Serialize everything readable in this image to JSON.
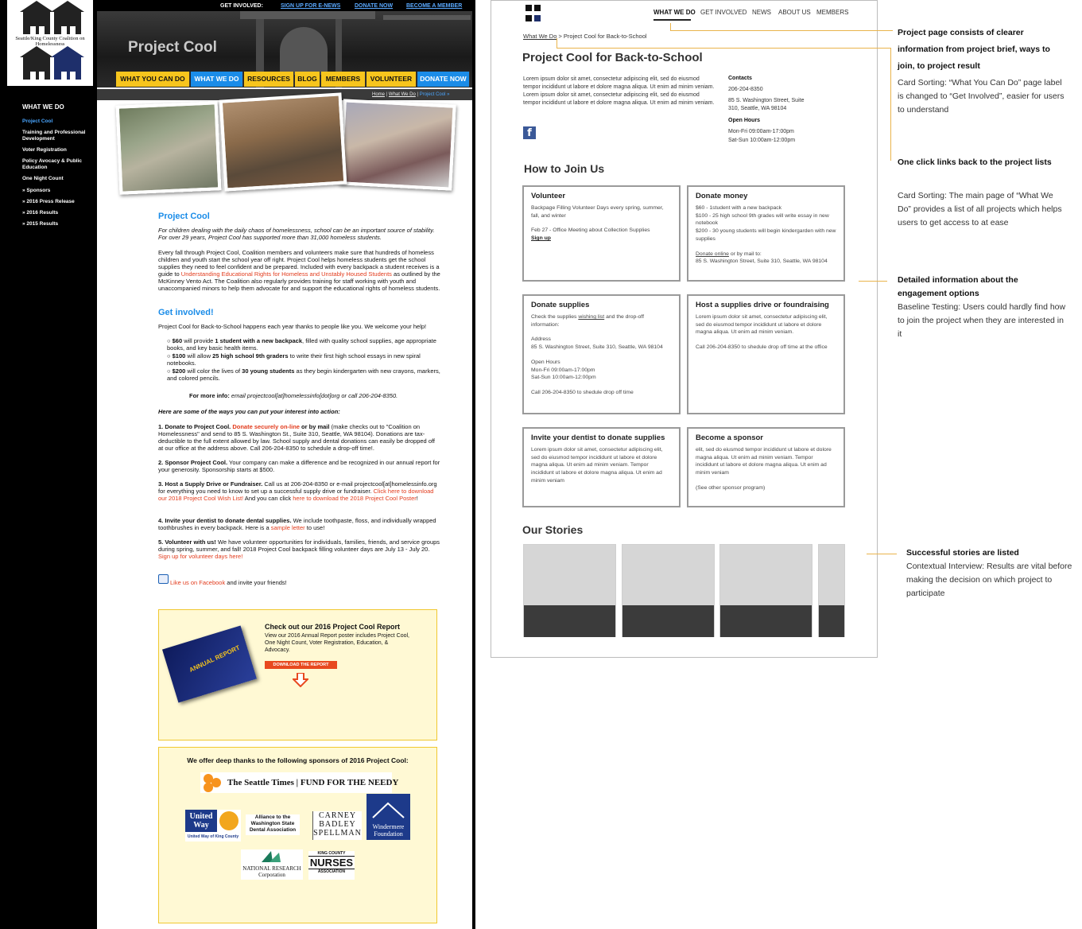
{
  "original": {
    "logo_text": "Seattle/King County Coalition on Homelessness",
    "top_links": {
      "label": "GET INVOLVED:",
      "enews": "SIGN UP FOR E-NEWS",
      "donate": "DONATE NOW",
      "member": "BECOME A MEMBER"
    },
    "hero_title": "Project Cool",
    "nav": [
      "WHAT YOU CAN DO",
      "WHAT WE DO",
      "RESOURCES",
      "BLOG",
      "MEMBERS",
      "VOLUNTEER",
      "DONATE NOW"
    ],
    "breadcrumb": {
      "home": "Home",
      "sep": " | ",
      "section": "What We Do",
      "current": "Project Cool »"
    },
    "sidebar": {
      "title": "WHAT WE DO",
      "items": [
        "Project Cool",
        "Training and Professional Development",
        "Voter Registration",
        "Policy Avocacy & Public Education",
        "One Night Count",
        "» Sponsors",
        "» 2016 Press Release",
        "» 2016 Results",
        "» 2015 Results"
      ]
    },
    "heading1": "Project Cool",
    "intro_italic": "For children dealing with the daily chaos of homelessness, school can be an important source of stability. For over 29 years, Project Cool has supported more than 31,000 homeless students.",
    "para1_a": "Every fall through Project Cool, Coalition members and volunteers make sure that hundreds of homeless children and youth start the school year off right. Project Cool helps homeless students get the school supplies they need to feel confident and be prepared. Included with every backpack a student receives is a guide to ",
    "para1_link": "Understanding Educational Rights for Homeless and Unstably Housed Students",
    "para1_b": " as outlined by the McKinney Vento Act. The Coalition also regularly provides training for staff working with youth and unaccompanied minors to help them advocate for and support the educational rights of homeless students.",
    "heading2": "Get involved!",
    "get_involved_text": "Project Cool for Back-to-School happens each year thanks to people like you. We welcome your help!",
    "bullets": [
      {
        "amt": "$60",
        "mid": " will provide ",
        "bold": "1 student with a new backpack",
        "rest": ", filled with quality school supplies, age appropriate books, and key basic health items."
      },
      {
        "amt": "$100",
        "mid": " will allow ",
        "bold": "25 high school 9th graders",
        "rest": " to write their first high school essays in new spiral notebooks."
      },
      {
        "amt": "$200",
        "mid": " will color the lives of ",
        "bold": "30 young students",
        "rest": " as they begin kindergarten with new crayons, markers, and colored pencils."
      }
    ],
    "more_info_label": "For more info:",
    "more_info_text": " email projectcool[at]homelessinfo[dot]org or call 206-204-8350.",
    "ways_intro": "Here are some of the ways you can put your interest into action:",
    "ways": [
      {
        "bold": "1. Donate to Project Cool.",
        "link": " Donate securely on-line",
        "bold2": " or by mail",
        "rest": " (make checks out to \"Coalition on Homelessness\" and send to 85 S. Washington St., Suite 310, Seattle, WA 98104). Donations are tax-deductible to the full extent allowed by law. School supply and dental donations can easily be dropped off at our office at the address above. Call 206-204-8350 to schedule a drop-off time!."
      },
      {
        "bold": "2. Sponsor Project Cool.",
        "link": "",
        "bold2": "",
        "rest": " Your company can make a difference and be recognized in our annual report for your generosity. Sponsorship starts at $500."
      },
      {
        "bold": "3. Host a Supply Drive or Fundraiser.",
        "link": "",
        "bold2": "",
        "rest": " Call us at 206-204-8350 or e-mail projectcool[at]homelessinfo.org for everything you need to know to set up a successful supply drive or fundraiser. ",
        "link2": "Click here to download our 2018 Project Cool Wish List!",
        "rest2": " And you can click ",
        "link3": "here to download the 2018 Project Cool Poster",
        "rest3": "!"
      },
      {
        "bold": "4. Invite your dentist to donate dental supplies.",
        "link": "",
        "bold2": "",
        "rest": " We include toothpaste, floss, and individually wrapped toothbrushes in every backpack. Here is a ",
        "link2": "sample letter",
        "rest2": " to use!"
      },
      {
        "bold": "5. Volunteer with us!",
        "link": "",
        "bold2": "",
        "rest": " We have volunteer opportunities for individuals, families, friends, and service groups during spring, summer, and fall! 2018 Project Cool backpack filling volunteer days are July 13 - July 20. ",
        "link2": "Sign up for volunteer days here!"
      }
    ],
    "facebook_link": "Like us on Facebook",
    "facebook_rest": " and invite your friends!",
    "report": {
      "title": "Check out our 2016 Project Cool Report",
      "text": "View our 2016 Annual Report poster includes Project Cool, One Night Count, Voter Registration, Education, & Advocacy.",
      "book_label": "ANNUAL REPORT",
      "button": "DOWNLOAD THE REPORT"
    },
    "sponsors": {
      "title": "We offer deep thanks to the following sponsors of 2016 Project Cool:",
      "seattle_times": "The Seattle Times | FUND FOR THE NEEDY",
      "united_way": "United Way",
      "united_way_sub": "United Way of King County",
      "alliance": "Alliance to the Washington State Dental Association",
      "carney": "CARNEY BADLEY SPELLMAN",
      "windermere": "Windermere Foundation",
      "nrc": "NATIONAL RESEARCH Corporation",
      "kc_nurses_top": "KING COUNTY",
      "kc_nurses": "NURSES",
      "kc_nurses_bottom": "ASSOCIATION"
    }
  },
  "wireframe": {
    "nav": [
      "WHAT WE DO",
      "GET INVOLVED",
      "NEWS",
      "ABOUT US",
      "MEMBERS"
    ],
    "breadcrumb_link": "What We Do",
    "breadcrumb_rest": " > Project Cool for Back-to-School",
    "title": "Project Cool for Back-to-School",
    "intro": "Lorem ipsum dolor sit amet, consectetur adipiscing elit, sed do eiusmod tempor incididunt ut labore et dolore magna aliqua. Ut enim ad minim veniam. Lorem ipsum dolor sit amet, consectetur adipiscing elit, sed do eiusmod tempor incididunt ut labore et dolore magna aliqua. Ut enim ad minim veniam.",
    "contacts_label": "Contacts",
    "phone": "206-204-8350",
    "address": "85 S. Washington Street, Suite 310, Seattle, WA 98104",
    "hours_label": "Open Hours",
    "hours": [
      "Mon-Fri 09:00am-17:00pm",
      "Sat-Sun 10:00am-12:00pm"
    ],
    "how_to_join": "How to Join Us",
    "cards": [
      {
        "title": "Volunteer",
        "lines": [
          "Backpage Filling Volunteer Days every spring, summer, fall, and winter",
          "",
          "Feb 27 - Office Meeting about Collection Supplies"
        ],
        "link": "Sign up"
      },
      {
        "title": "Donate money",
        "lines": [
          "$60 - 1student with a new backpack",
          "$100 - 25 high school 9th grades will write essay in new notebook",
          "$200 - 30 young students will begin kindergarden with new supplies",
          ""
        ],
        "link": "Donate online",
        "after": " or by mail to:",
        "tail": "85 S. Washington Street, Suite 310, Seattle, WA 98104"
      },
      {
        "title": "Donate supplies",
        "pre": "Check the supplies ",
        "link": "wishing list",
        "after": " and the drop-off information:",
        "lines": [
          "",
          "Address",
          "85 S. Washington Street, Suite 310, Seattle, WA 98104",
          "",
          "Open Hours",
          "Mon-Fri 09:00am-17:00pm",
          "Sat-Sun 10:00am-12:00pm",
          "",
          "Call 206-204-8350 to shedule drop off time"
        ]
      },
      {
        "title": "Host a supplies drive or foundraising",
        "lines": [
          "Lorem ipsum dolor sit amet, consectetur adipiscing elit, sed do eiusmod tempor incididunt ut labore et dolore magna aliqua. Ut enim ad minim veniam.",
          "",
          "Call 206-204-8350 to shedule drop off time at the office"
        ]
      },
      {
        "title": "Invite your dentist to donate supplies",
        "lines": [
          "Lorem ipsum dolor sit amet, consectetur adipiscing elit, sed do eiusmod tempor incididunt ut labore et dolore magna aliqua. Ut enim ad minim veniam. Tempor incididunt ut labore et dolore magna aliqua. Ut enim ad minim veniam"
        ]
      },
      {
        "title": "Become a sponsor",
        "lines": [
          "elit, sed do eiusmod tempor incididunt ut labore et dolore magna aliqua. Ut enim ad minim veniam. Tempor incididunt ut labore et dolore magna aliqua. Ut enim ad minim veniam",
          "",
          "(See other sponsor program)"
        ]
      }
    ],
    "our_stories": "Our Stories"
  },
  "annotations": [
    {
      "heading": "Project page consists of clearer information from project brief, ways to join, to project result",
      "body": "Card Sorting: “What You Can Do” page label is changed to “Get Involved”, easier for users to understand"
    },
    {
      "heading": "One click links back to the project lists",
      "body": "Card Sorting: The main page of “What We Do” provides a list of all projects which helps users to get access to at ease"
    },
    {
      "heading": "Detailed information about the engagement options",
      "body": "Baseline Testing: Users could hardly find how to join the project when they are interested in it"
    },
    {
      "heading": "Successful stories are listed",
      "body": "Contextual Interview: Results are vital before making the decision on which project to participate"
    }
  ],
  "colors": {
    "accent_yellow": "#f7c51d",
    "accent_blue": "#1a8ce8",
    "link_red": "#e23b1c",
    "annotation_line": "#e9b44c"
  }
}
